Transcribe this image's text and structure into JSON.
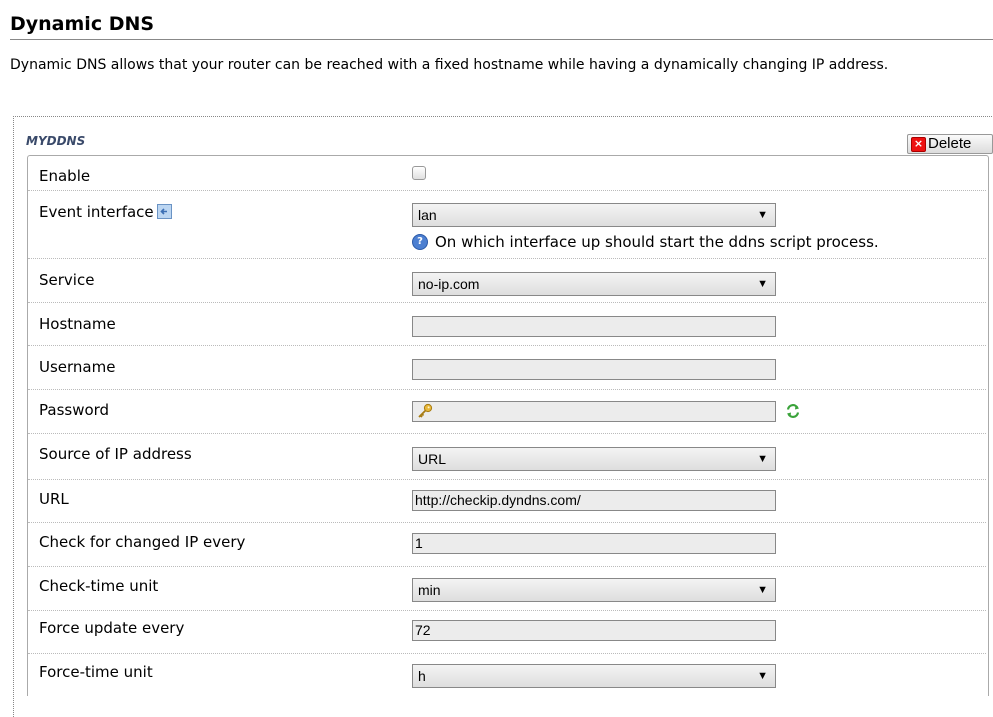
{
  "page": {
    "title": "Dynamic DNS",
    "description": "Dynamic DNS allows that your router can be reached with a fixed hostname while having a dynamically changing IP address."
  },
  "section": {
    "name": "MYDDNS",
    "delete_label": "Delete"
  },
  "fields": {
    "enable": {
      "label": "Enable",
      "checked": false
    },
    "event_interface": {
      "label": "Event interface",
      "value": "lan",
      "help": "On which interface up should start the ddns script process."
    },
    "service": {
      "label": "Service",
      "value": "no-ip.com"
    },
    "hostname": {
      "label": "Hostname",
      "value": ""
    },
    "username": {
      "label": "Username",
      "value": ""
    },
    "password": {
      "label": "Password",
      "value": ""
    },
    "ip_source": {
      "label": "Source of IP address",
      "value": "URL"
    },
    "url": {
      "label": "URL",
      "value": "http://checkip.dyndns.com/"
    },
    "check_interval": {
      "label": "Check for changed IP every",
      "value": "1"
    },
    "check_unit": {
      "label": "Check-time unit",
      "value": "min"
    },
    "force_interval": {
      "label": "Force update every",
      "value": "72"
    },
    "force_unit": {
      "label": "Force-time unit",
      "value": "h"
    }
  },
  "icons": {
    "delete": "delete-icon",
    "interface": "network-interface-icon",
    "help": "help-icon",
    "key": "key-icon",
    "reload": "reload-icon"
  },
  "colors": {
    "delete_icon": "#e11111",
    "help_icon": "#4c7fd1",
    "reload_icon": "#3aa33a",
    "key_icon": "#d9a520"
  }
}
